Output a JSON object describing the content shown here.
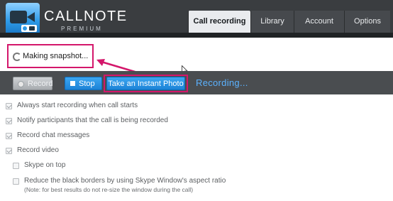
{
  "app": {
    "brand_name": "CALLNOTE",
    "brand_sub": "PREMIUM"
  },
  "nav": {
    "tabs": [
      {
        "label": "Call recording",
        "active": true
      },
      {
        "label": "Library",
        "active": false
      },
      {
        "label": "Account",
        "active": false
      },
      {
        "label": "Options",
        "active": false
      }
    ]
  },
  "status": {
    "snapshot_text": "Making snapshot..."
  },
  "controls": {
    "record_label": "Record",
    "stop_label": "Stop",
    "photo_label": "Take an Instant Photo",
    "recording_label": "Recording..."
  },
  "settings": {
    "options": [
      {
        "label": "Always start recording when call starts",
        "checked": true
      },
      {
        "label": "Notify participants that the call is being recorded",
        "checked": true
      },
      {
        "label": "Record chat messages",
        "checked": true
      },
      {
        "label": "Record video",
        "checked": true
      },
      {
        "label": "Skype on top",
        "checked": false
      },
      {
        "label": "Reduce the black borders by using Skype Window's aspect ratio",
        "checked": false
      }
    ],
    "note": "(Note: for best results do not re-size the window during the call)"
  },
  "colors": {
    "header_bg": "#3a3d40",
    "controls_bg": "#4a4d50",
    "accent_blue": "#1c82d6",
    "highlight": "#d4176b",
    "recording_text": "#5bb2ff"
  },
  "icons": [
    "camera-logo-icon",
    "spinner-icon",
    "record-dot-icon",
    "stop-icon",
    "mouse-cursor-icon",
    "checkbox-icon"
  ]
}
